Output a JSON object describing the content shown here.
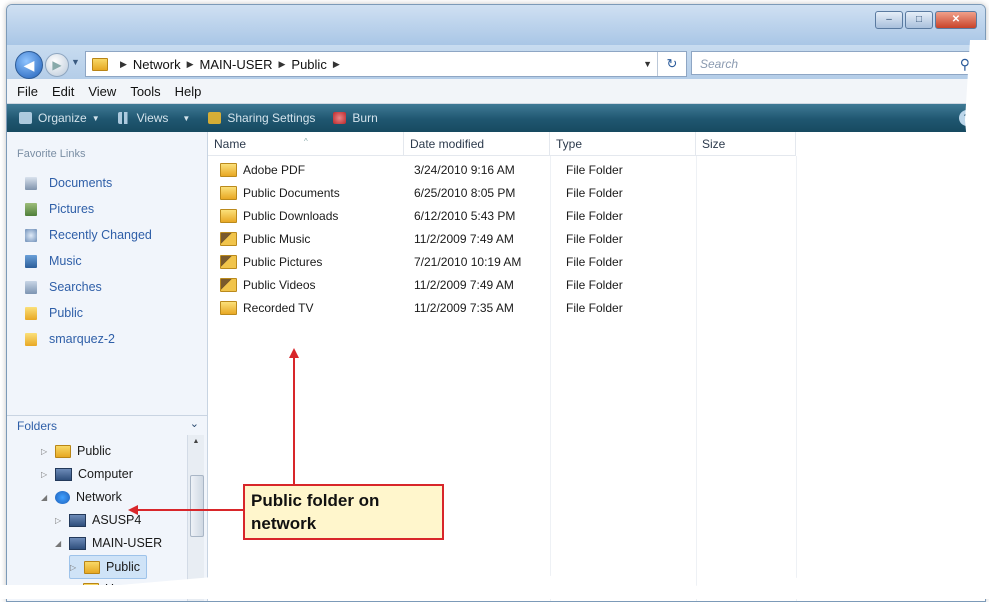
{
  "window": {
    "controls": {
      "minimize": "–",
      "maximize": "□",
      "close": "✕"
    }
  },
  "address": {
    "crumbs": [
      "Network",
      "MAIN-USER",
      "Public"
    ],
    "search_placeholder": "Search"
  },
  "menu": [
    "File",
    "Edit",
    "View",
    "Tools",
    "Help"
  ],
  "toolbar": {
    "organize": "Organize",
    "views": "Views",
    "sharing": "Sharing Settings",
    "burn": "Burn"
  },
  "nav": {
    "favorites_title": "Favorite Links",
    "favorites": [
      {
        "label": "Documents",
        "icon": "documents-icon"
      },
      {
        "label": "Pictures",
        "icon": "pictures-icon"
      },
      {
        "label": "Recently Changed",
        "icon": "recently-changed-icon"
      },
      {
        "label": "Music",
        "icon": "music-icon"
      },
      {
        "label": "Searches",
        "icon": "searches-icon"
      },
      {
        "label": "Public",
        "icon": "folder-icon"
      },
      {
        "label": "smarquez-2",
        "icon": "folder-icon"
      }
    ],
    "folders_title": "Folders",
    "tree": [
      {
        "label": "Public",
        "icon": "folder-icon",
        "expander": "▷",
        "indent": 1
      },
      {
        "label": "Computer",
        "icon": "computer-icon",
        "expander": "▷",
        "indent": 1
      },
      {
        "label": "Network",
        "icon": "network-icon",
        "expander": "◢",
        "indent": 1
      },
      {
        "label": "ASUSP4",
        "icon": "computer-icon",
        "expander": "▷",
        "indent": 2
      },
      {
        "label": "MAIN-USER",
        "icon": "computer-icon",
        "expander": "◢",
        "indent": 2
      },
      {
        "label": "Public",
        "icon": "folder-icon",
        "expander": "▷",
        "indent": 3,
        "selected": true
      },
      {
        "label": "Users",
        "icon": "folder-icon",
        "expander": "▷",
        "indent": 3
      }
    ]
  },
  "columns": [
    "Name",
    "Date modified",
    "Type",
    "Size"
  ],
  "files": [
    {
      "name": "Adobe PDF",
      "date": "3/24/2010 9:16 AM",
      "type": "File Folder",
      "icon": "folder-icon"
    },
    {
      "name": "Public Documents",
      "date": "6/25/2010 8:05 PM",
      "type": "File Folder",
      "icon": "folder-icon"
    },
    {
      "name": "Public Downloads",
      "date": "6/12/2010 5:43 PM",
      "type": "File Folder",
      "icon": "folder-icon"
    },
    {
      "name": "Public Music",
      "date": "11/2/2009 7:49 AM",
      "type": "File Folder",
      "icon": "music-folder-icon"
    },
    {
      "name": "Public Pictures",
      "date": "7/21/2010 10:19 AM",
      "type": "File Folder",
      "icon": "pictures-folder-icon"
    },
    {
      "name": "Public Videos",
      "date": "11/2/2009 7:49 AM",
      "type": "File Folder",
      "icon": "videos-folder-icon"
    },
    {
      "name": "Recorded TV",
      "date": "11/2/2009 7:35 AM",
      "type": "File Folder",
      "icon": "folder-icon"
    }
  ],
  "callout": {
    "text": "Public folder on network",
    "color": "#d8262a"
  }
}
